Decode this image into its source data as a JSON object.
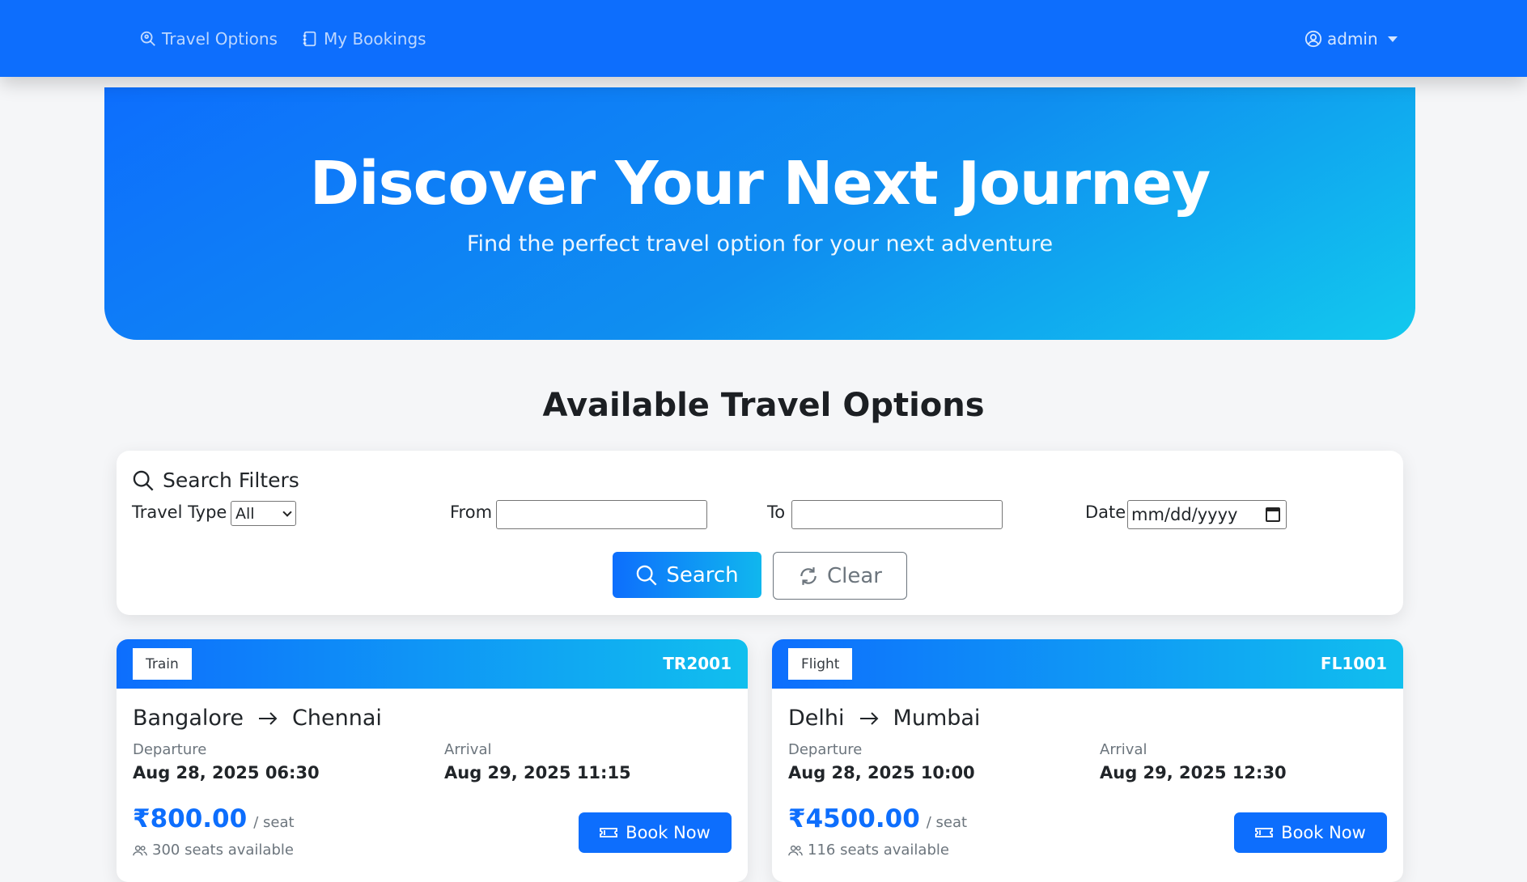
{
  "nav": {
    "travel_options": "Travel Options",
    "my_bookings": "My Bookings",
    "user": "admin"
  },
  "hero": {
    "title": "Discover Your Next Journey",
    "subtitle": "Find the perfect travel option for your next adventure"
  },
  "section_title": "Available Travel Options",
  "filters": {
    "title": "Search Filters",
    "travel_type_label": "Travel Type",
    "travel_type_value": "All",
    "from_label": "From",
    "from_value": "",
    "to_label": "To",
    "to_value": "",
    "date_label": "Date",
    "date_placeholder": "mm/dd/yyyy",
    "search_label": "Search",
    "clear_label": "Clear"
  },
  "cards": [
    {
      "type": "Train",
      "code": "TR2001",
      "from": "Bangalore",
      "to": "Chennai",
      "departure_label": "Departure",
      "departure": "Aug 28, 2025 06:30",
      "arrival_label": "Arrival",
      "arrival": "Aug 29, 2025 11:15",
      "price": "₹800.00",
      "unit": "/ seat",
      "seats": "300 seats available",
      "book_label": "Book Now"
    },
    {
      "type": "Flight",
      "code": "FL1001",
      "from": "Delhi",
      "to": "Mumbai",
      "departure_label": "Departure",
      "departure": "Aug 28, 2025 10:00",
      "arrival_label": "Arrival",
      "arrival": "Aug 29, 2025 12:30",
      "price": "₹4500.00",
      "unit": "/ seat",
      "seats": "116 seats available",
      "book_label": "Book Now"
    }
  ],
  "colors": {
    "primary": "#0d6efd",
    "accent_cyan": "#12c9ee",
    "muted": "#6c757d",
    "background": "#f5f6f8"
  },
  "icons": {
    "travel_options": "search-location-icon",
    "my_bookings": "journal-icon",
    "user": "person-circle-icon",
    "search": "search-icon",
    "clear": "refresh-icon",
    "arrow": "arrow-right-icon",
    "seats": "people-icon",
    "book": "ticket-icon"
  }
}
